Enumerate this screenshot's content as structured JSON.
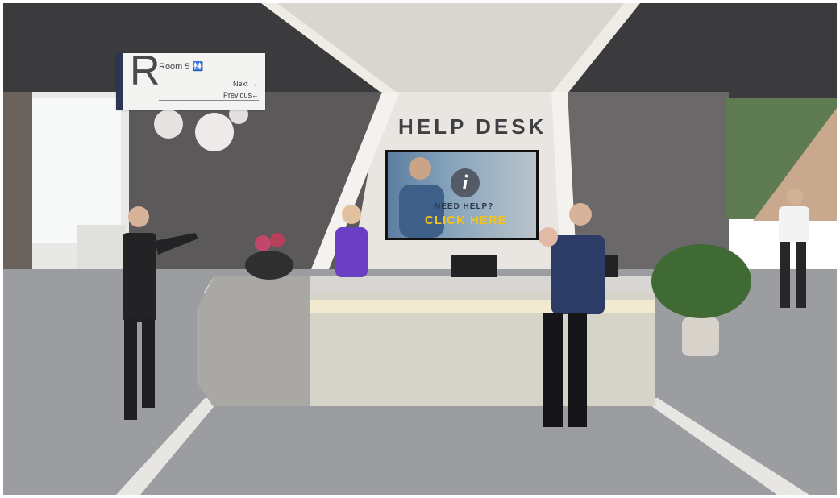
{
  "scene": {
    "description_free": true,
    "help_desk_title": "HELP DESK",
    "sign": {
      "letter": "R",
      "room": "Room 5 🚻",
      "next": "Next →",
      "previous": "Previous←"
    },
    "screen": {
      "icon": "info-icon",
      "need_help": "NEED HELP?",
      "click_here": "CLICK HERE"
    },
    "colors": {
      "wall_dark": "#5a5758",
      "floor": "#9a9c9f",
      "accent_stripe": "#e9e6df",
      "desk": "#c9c8c3",
      "desk_glow": "#efe7c9",
      "sign_bar": "#2c3552",
      "click_text": "#f1c21b"
    }
  }
}
